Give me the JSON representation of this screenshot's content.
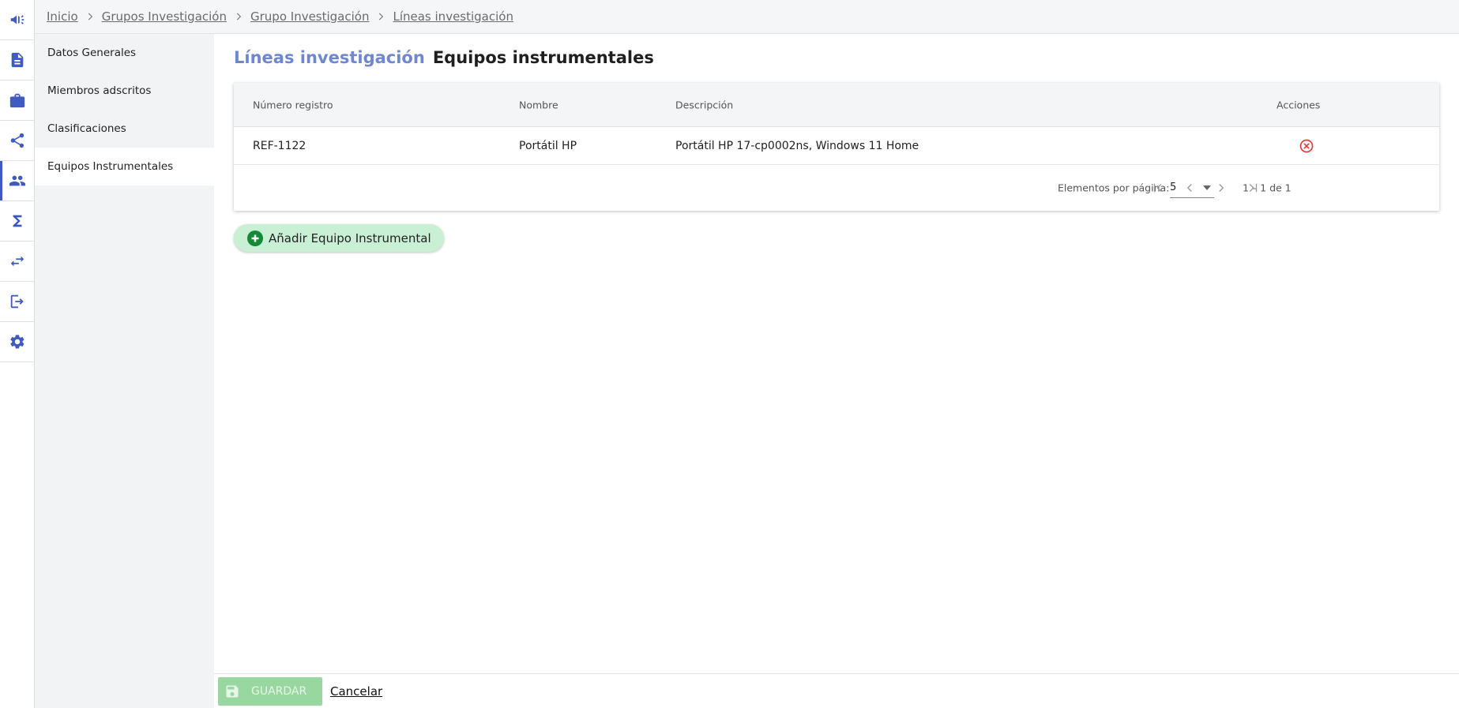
{
  "rail": {
    "items": [
      {
        "icon": "megaphone-icon"
      },
      {
        "icon": "document-icon"
      },
      {
        "icon": "briefcase-icon"
      },
      {
        "icon": "share-icon"
      },
      {
        "icon": "people-icon",
        "active": true
      },
      {
        "icon": "sigma-icon"
      },
      {
        "icon": "swap-arrows-icon"
      },
      {
        "icon": "logout-icon"
      },
      {
        "icon": "gear-icon"
      }
    ]
  },
  "breadcrumb": {
    "items": [
      "Inicio",
      "Grupos Investigación",
      "Grupo Investigación",
      "Líneas investigación"
    ]
  },
  "sections": {
    "items": [
      {
        "label": "Datos Generales"
      },
      {
        "label": "Miembros adscritos"
      },
      {
        "label": "Clasificaciones"
      },
      {
        "label": "Equipos Instrumentales",
        "active": true
      }
    ]
  },
  "title": {
    "crumb": "Líneas investigación",
    "current": "Equipos instrumentales"
  },
  "table": {
    "headers": [
      "Número registro",
      "Nombre",
      "Descripción",
      "Acciones"
    ],
    "rows": [
      {
        "numero": "REF-1122",
        "nombre": "Portátil HP",
        "descripcion": "Portátil HP 17-cp0002ns, Windows 11 Home",
        "action_icon": "delete-circle-icon"
      }
    ]
  },
  "paginator": {
    "label": "Elementos por página:",
    "page_size": "5",
    "range": "1 – 1 de 1"
  },
  "add_button": {
    "label": "Añadir Equipo Instrumental"
  },
  "footer": {
    "save_label": "GUARDAR",
    "cancel_label": "Cancelar"
  },
  "colors": {
    "accent": "#3f5bbf",
    "title_crumb": "#6f86d0",
    "delete": "#e53935",
    "add_bg": "#c9f0d4",
    "save_bg": "#98d79f"
  }
}
